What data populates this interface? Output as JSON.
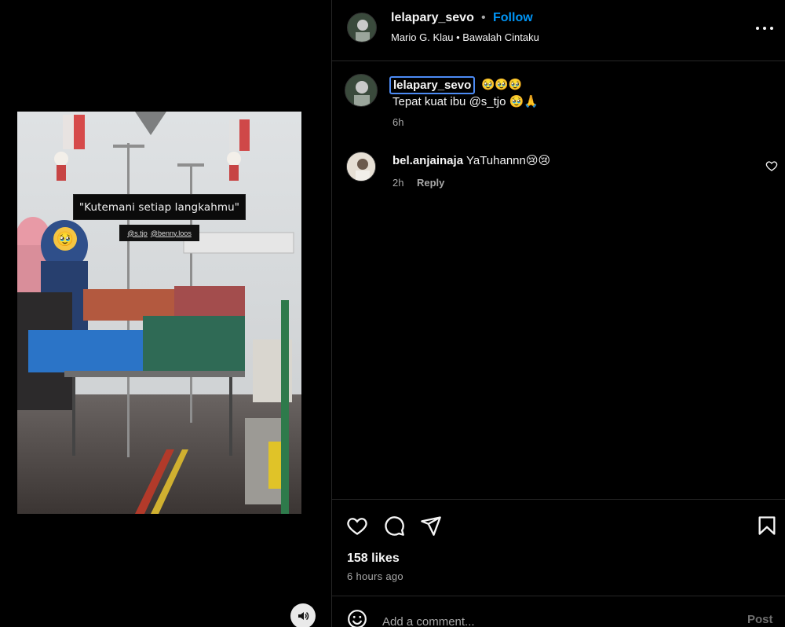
{
  "media": {
    "caption_text": "\"Kutemani setiap langkahmu\"",
    "mention_1": "@s.tjo",
    "mention_2": "@benny.loos",
    "sticker_emoji": "🥹",
    "audio_icon": "speaker-icon"
  },
  "header": {
    "username": "lelapary_sevo",
    "dot": "•",
    "follow_label": "Follow",
    "subtitle": "Mario G. Klau • Bawalah Cintaku",
    "more_icon": "more-options-icon"
  },
  "comments": [
    {
      "username": "lelapary_sevo",
      "emoji": "🥹🥹🥹",
      "text": "Tepat kuat ibu @s_tjo 🥹🙏",
      "time": "6h"
    },
    {
      "username": "bel.anjainaja",
      "text": "YaTuhannn😢😢",
      "time": "2h",
      "reply_label": "Reply"
    }
  ],
  "footer": {
    "likes": "158 likes",
    "time_ago": "6 hours ago",
    "add_comment_placeholder": "Add a comment...",
    "post_label": "Post"
  },
  "colors": {
    "background": "#000000",
    "accent": "#0095f6",
    "muted": "#a8a8a8",
    "divider": "#262626"
  }
}
